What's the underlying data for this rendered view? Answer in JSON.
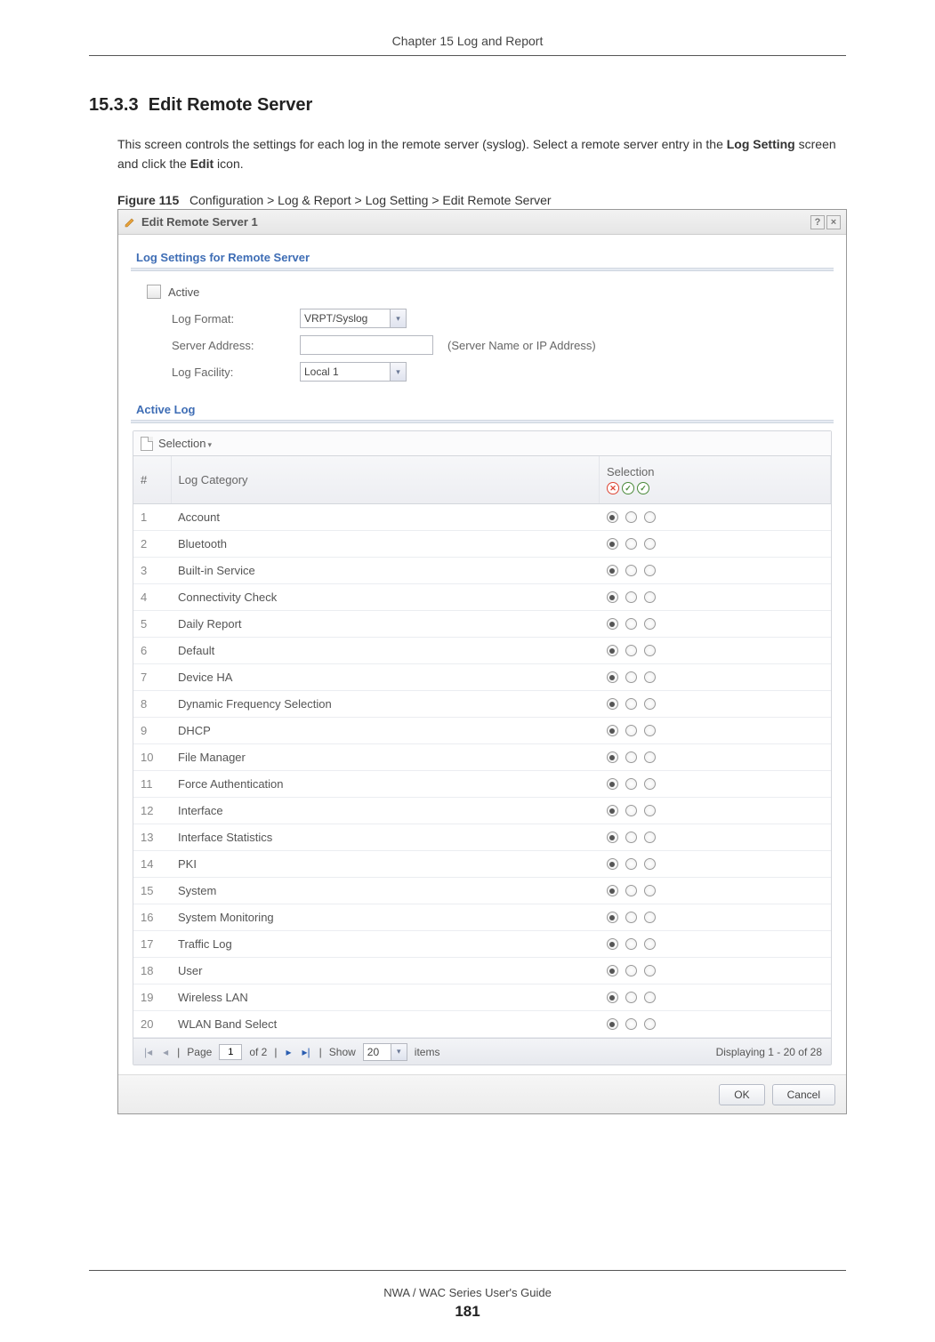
{
  "doc": {
    "chapter_header": "Chapter 15 Log and Report",
    "section_number": "15.3.3",
    "section_title": "Edit Remote Server",
    "body_prefix": "This screen controls the settings for each log in the remote server (syslog). Select a remote server entry in the ",
    "body_bold1": "Log Setting",
    "body_mid": " screen and click the ",
    "body_bold2": "Edit",
    "body_suffix": " icon.",
    "figure_label": "Figure 115",
    "figure_caption": "Configuration > Log & Report > Log Setting > Edit Remote Server",
    "footer": "NWA / WAC Series User's Guide",
    "page_number": "181"
  },
  "dialog": {
    "title": "Edit Remote Server 1",
    "help_symbol": "?",
    "close_symbol": "×",
    "panel1_title": "Log Settings for Remote Server",
    "active_label": "Active",
    "log_format_label": "Log Format:",
    "log_format_value": "VRPT/Syslog",
    "server_address_label": "Server Address:",
    "server_address_value": "",
    "server_address_hint": "(Server Name or IP Address)",
    "log_facility_label": "Log Facility:",
    "log_facility_value": "Local 1",
    "panel2_title": "Active Log",
    "selection_button": "Selection",
    "col_num": "#",
    "col_category": "Log Category",
    "col_selection": "Selection",
    "rows": [
      {
        "n": "1",
        "cat": "Account"
      },
      {
        "n": "2",
        "cat": "Bluetooth"
      },
      {
        "n": "3",
        "cat": "Built-in Service"
      },
      {
        "n": "4",
        "cat": "Connectivity Check"
      },
      {
        "n": "5",
        "cat": "Daily Report"
      },
      {
        "n": "6",
        "cat": "Default"
      },
      {
        "n": "7",
        "cat": "Device HA"
      },
      {
        "n": "8",
        "cat": "Dynamic Frequency Selection"
      },
      {
        "n": "9",
        "cat": "DHCP"
      },
      {
        "n": "10",
        "cat": "File Manager"
      },
      {
        "n": "11",
        "cat": "Force Authentication"
      },
      {
        "n": "12",
        "cat": "Interface"
      },
      {
        "n": "13",
        "cat": "Interface Statistics"
      },
      {
        "n": "14",
        "cat": "PKI"
      },
      {
        "n": "15",
        "cat": "System"
      },
      {
        "n": "16",
        "cat": "System Monitoring"
      },
      {
        "n": "17",
        "cat": "Traffic Log"
      },
      {
        "n": "18",
        "cat": "User"
      },
      {
        "n": "19",
        "cat": "Wireless LAN"
      },
      {
        "n": "20",
        "cat": "WLAN Band Select"
      }
    ],
    "pager": {
      "page_label": "Page",
      "page_value": "1",
      "of_label": "of 2",
      "show_label": "Show",
      "show_value": "20",
      "items_label": "items",
      "display_text": "Displaying 1 - 20 of 28"
    },
    "ok_label": "OK",
    "cancel_label": "Cancel"
  }
}
